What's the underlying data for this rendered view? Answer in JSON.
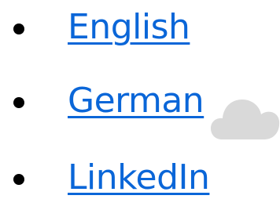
{
  "links": [
    {
      "label": "English"
    },
    {
      "label": "German"
    },
    {
      "label": "LinkedIn"
    }
  ],
  "icons": {
    "bullet": "bullet-dot-icon",
    "cloud": "cloud-icon"
  },
  "colors": {
    "link": "#0a66d8",
    "bullet": "#000000",
    "cloud": "#d9d9d9"
  }
}
